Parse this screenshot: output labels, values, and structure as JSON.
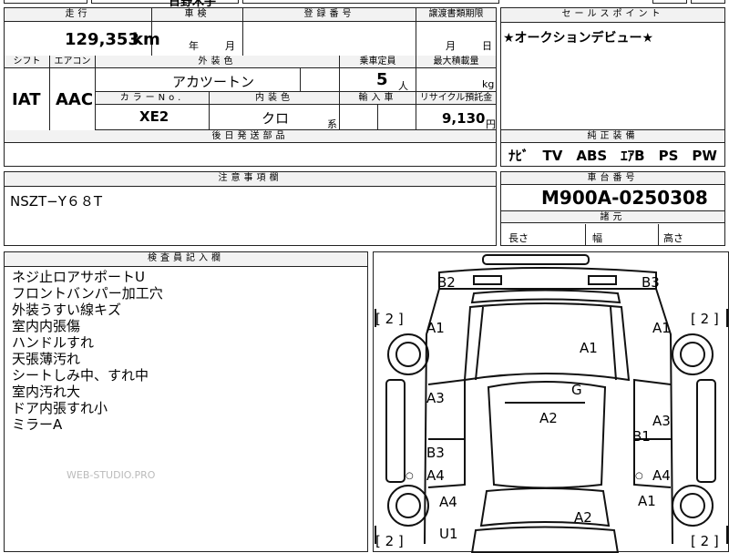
{
  "sheet": {
    "top_partial": "日野木子",
    "mileage": {
      "header": "走行",
      "value": "129,353",
      "unit": "km"
    },
    "inspection": {
      "header": "車検",
      "year_label": "年",
      "month_label": "月"
    },
    "registration": {
      "header": "登録番号"
    },
    "transfer_docs": {
      "header": "譲渡書類期限",
      "month_label": "月",
      "day_label": "日"
    },
    "sales_point": {
      "header": "セールスポイント",
      "text": "★オークションデビュー★"
    },
    "shift": {
      "header": "シフト",
      "value": "IAT"
    },
    "aircon": {
      "header": "エアコン",
      "value": "AAC"
    },
    "exterior": {
      "header": "外装色",
      "value": "アカツートン"
    },
    "capacity": {
      "header": "乗車定員",
      "value": "5",
      "unit": "人"
    },
    "max_load": {
      "header": "最大積載量",
      "unit": "kg"
    },
    "color_no": {
      "header": "カラーNo.",
      "value": "XE2"
    },
    "interior": {
      "header": "内装色",
      "value": "クロ",
      "suffix": "系"
    },
    "import": {
      "header": "輸入車"
    },
    "recycle": {
      "header": "リサイクル預託金",
      "value": "9,130",
      "unit": "円"
    },
    "later_parts": {
      "header": "後日発送部品"
    },
    "equipment": {
      "header": "純正装備",
      "value": "ﾅﾋﾞ　TV　ABS　ｴｱB　PS　PW"
    },
    "caution": {
      "header": "注意事項欄",
      "value": "NSZT−Y６８T"
    },
    "chassis": {
      "header": "車台番号",
      "value": "M900A-0250308"
    },
    "dimensions": {
      "header": "諸元",
      "length": "長さ",
      "width": "幅",
      "height": "高さ"
    },
    "inspector": {
      "header": "検査員記入欄",
      "notes": [
        "ネジ止ロアサポートU",
        "フロントバンパー加工穴",
        "外装うすい線キズ",
        "室内内張傷",
        "ハンドルすれ",
        "天張薄汚れ",
        "シートしみ中、すれ中",
        "室内汚れ大",
        "ドア内張すれ小",
        "ミラーA"
      ]
    },
    "watermark": "WEB-STUDIO.PRO",
    "diagram": {
      "marks": [
        "B2",
        "B3",
        "A1",
        "A1",
        "A1",
        "A3",
        "G",
        "A2",
        "A3",
        "B1",
        "B3",
        "A4",
        "A4",
        "A4",
        "A4",
        "A1",
        "A2",
        "U1"
      ],
      "brackets": [
        "[ 2 ]",
        "[ 2 ]",
        "[ 2 ]",
        "[ 2 ]"
      ]
    }
  }
}
